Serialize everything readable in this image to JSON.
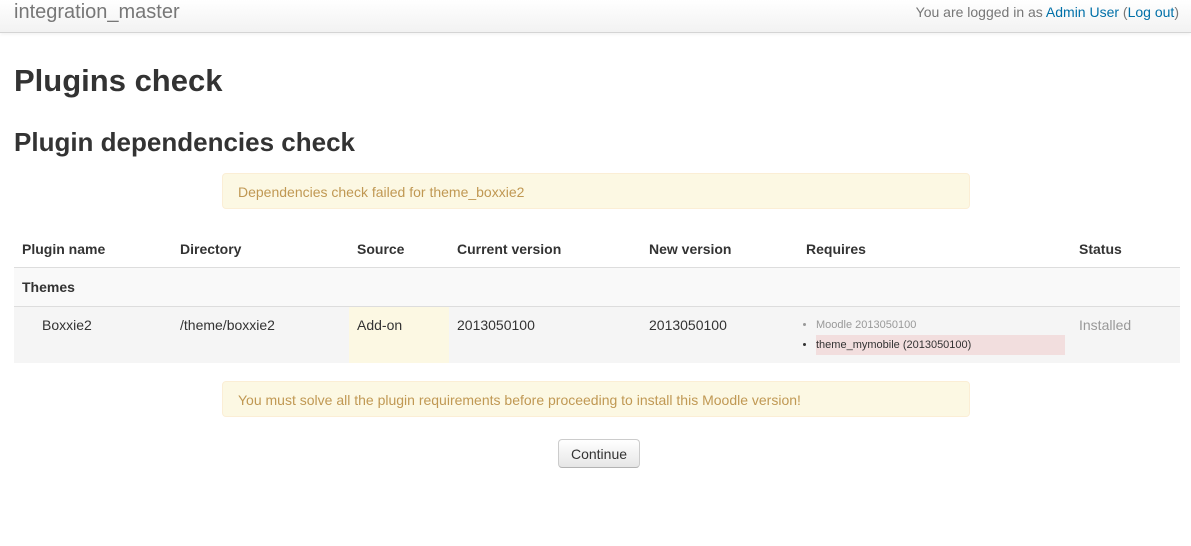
{
  "navbar": {
    "brand": "integration_master",
    "logged_in_prefix": "You are logged in as ",
    "user_name": "Admin User",
    "logout_open": " (",
    "logout_label": "Log out",
    "logout_close": ")"
  },
  "page": {
    "title": "Plugins check",
    "section_title": "Plugin dependencies check",
    "alert_top": "Dependencies check failed for theme_boxxie2",
    "alert_bottom": "You must solve all the plugin requirements before proceeding to install this Moodle version!",
    "continue_label": "Continue"
  },
  "table": {
    "headers": [
      "Plugin name",
      "Directory",
      "Source",
      "Current version",
      "New version",
      "Requires",
      "Status"
    ],
    "group_label": "Themes",
    "rows": [
      {
        "name": "Boxxie2",
        "directory": "/theme/boxxie2",
        "source": "Add-on",
        "current_version": "2013050100",
        "new_version": "2013050100",
        "requires": [
          {
            "text": "Moodle 2013050100",
            "status": "ok"
          },
          {
            "text": "theme_mymobile (2013050100)",
            "status": "missing"
          }
        ],
        "status": "Installed"
      }
    ]
  },
  "colors": {
    "link": "#0070a8",
    "alert_bg": "#fcf8e3",
    "alert_text": "#c09853",
    "requirement_missing_bg": "#f2dede"
  }
}
